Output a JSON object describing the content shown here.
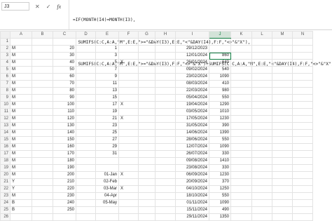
{
  "formula_bar": {
    "name_box": "J3",
    "cancel_icon": "✕",
    "confirm_icon": "✓",
    "fx_label": "fx",
    "formula_lines": [
      "=IF(MONTH(I4)=MONTH(I3),",
      "  SUMIFS(C:C,A:A,\"M\",E:E,\">=\"&DAY(I3),E:E,\"<\"&DAY(I4),F:F,\"<>\"&\"X\"),",
      "  SUMIFS(C:C,A:A,\"M\",E:E,\">=\"&DAY(I3),F:F,\"<>\"&\"X\")+SUMIFS(C:C,A:A,\"M\",E:E,\"<\"&DAY(I4),F:F,\"<>\"&\"X\"))"
    ]
  },
  "columns": [
    "A",
    "B",
    "C",
    "D",
    "E",
    "F",
    "G",
    "H",
    "I",
    "J",
    "K",
    "L",
    "M",
    "N"
  ],
  "selected_column": "J",
  "rows": [
    {
      "n": "1",
      "a": "",
      "c": "",
      "e": "",
      "f": "",
      "i": "",
      "j": ""
    },
    {
      "n": "2",
      "a": "M",
      "c": "20",
      "e": "1",
      "f": "",
      "i": "29/12/2023",
      "j": ""
    },
    {
      "n": "3",
      "a": "M",
      "c": "30",
      "e": "3",
      "f": "",
      "i": "12/01/2024",
      "j": "860"
    },
    {
      "n": "4",
      "a": "M",
      "c": "40",
      "e": "5",
      "f": "X",
      "i": "26/01/2024",
      "j": "640"
    },
    {
      "n": "5",
      "a": "M",
      "c": "50",
      "e": "7",
      "f": "",
      "i": "09/02/2024",
      "j": "540"
    },
    {
      "n": "6",
      "a": "M",
      "c": "60",
      "e": "9",
      "f": "",
      "i": "23/02/2024",
      "j": "1090"
    },
    {
      "n": "7",
      "a": "M",
      "c": "70",
      "e": "11",
      "f": "",
      "i": "08/03/2024",
      "j": "410"
    },
    {
      "n": "8",
      "a": "M",
      "c": "80",
      "e": "13",
      "f": "",
      "i": "22/03/2024",
      "j": "980"
    },
    {
      "n": "9",
      "a": "M",
      "c": "90",
      "e": "15",
      "f": "",
      "i": "05/04/2024",
      "j": "550"
    },
    {
      "n": "10",
      "a": "M",
      "c": "100",
      "e": "17",
      "f": "X",
      "i": "19/04/2024",
      "j": "1290"
    },
    {
      "n": "11",
      "a": "M",
      "c": "110",
      "e": "19",
      "f": "",
      "i": "03/05/2024",
      "j": "1010"
    },
    {
      "n": "12",
      "a": "M",
      "c": "120",
      "e": "21",
      "f": "X",
      "i": "17/05/2024",
      "j": "1230"
    },
    {
      "n": "13",
      "a": "M",
      "c": "130",
      "e": "23",
      "f": "",
      "i": "31/05/2024",
      "j": "390"
    },
    {
      "n": "14",
      "a": "M",
      "c": "140",
      "e": "25",
      "f": "",
      "i": "14/06/2024",
      "j": "1390"
    },
    {
      "n": "15",
      "a": "M",
      "c": "150",
      "e": "27",
      "f": "",
      "i": "28/06/2024",
      "j": "550"
    },
    {
      "n": "16",
      "a": "M",
      "c": "160",
      "e": "29",
      "f": "",
      "i": "12/07/2024",
      "j": "1090"
    },
    {
      "n": "17",
      "a": "M",
      "c": "170",
      "e": "31",
      "f": "",
      "i": "26/07/2024",
      "j": "330"
    },
    {
      "n": "18",
      "a": "M",
      "c": "180",
      "e": "",
      "f": "",
      "i": "09/08/2024",
      "j": "1410"
    },
    {
      "n": "19",
      "a": "M",
      "c": "190",
      "e": "",
      "f": "",
      "i": "23/08/2024",
      "j": "330"
    },
    {
      "n": "20",
      "a": "M",
      "c": "200",
      "e": "01-Jan",
      "f": "X",
      "i": "06/09/2024",
      "j": "1230"
    },
    {
      "n": "21",
      "a": "Y",
      "c": "210",
      "e": "02-Feb",
      "f": "",
      "i": "20/09/2024",
      "j": "370"
    },
    {
      "n": "22",
      "a": "Y",
      "c": "220",
      "e": "03-Mar",
      "f": "X",
      "i": "04/10/2024",
      "j": "1250"
    },
    {
      "n": "23",
      "a": "M",
      "c": "230",
      "e": "04-Apr",
      "f": "",
      "i": "18/10/2024",
      "j": "550"
    },
    {
      "n": "24",
      "a": "B",
      "c": "240",
      "e": "05-May",
      "f": "",
      "i": "01/11/2024",
      "j": "1090"
    },
    {
      "n": "25",
      "a": "B",
      "c": "250",
      "e": "",
      "f": "",
      "i": "15/11/2024",
      "j": "490"
    },
    {
      "n": "26",
      "a": "",
      "c": "",
      "e": "",
      "f": "",
      "i": "29/11/2024",
      "j": "1350"
    }
  ],
  "selected_cell": "J3"
}
